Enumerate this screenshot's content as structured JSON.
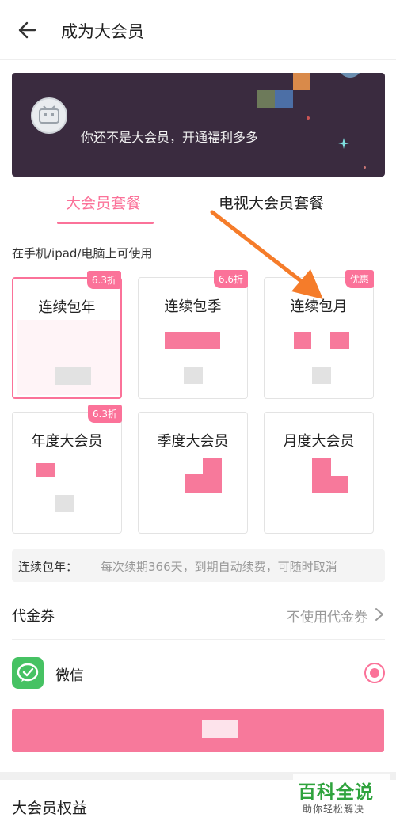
{
  "header": {
    "title": "成为大会员"
  },
  "banner": {
    "text": "你还不是大会员，开通福利多多"
  },
  "tabs": [
    {
      "label": "大会员套餐",
      "active": true
    },
    {
      "label": "电视大会员套餐",
      "active": false
    }
  ],
  "device_note": "在手机/ipad/电脑上可使用",
  "plans": [
    {
      "name": "连续包年",
      "badge": "6.3折",
      "selected": true
    },
    {
      "name": "连续包季",
      "badge": "6.6折",
      "selected": false
    },
    {
      "name": "连续包月",
      "badge": "优惠",
      "selected": false
    },
    {
      "name": "年度大会员",
      "badge": "6.3折",
      "selected": false
    },
    {
      "name": "季度大会员",
      "badge": "",
      "selected": false
    },
    {
      "name": "月度大会员",
      "badge": "",
      "selected": false
    }
  ],
  "notice": {
    "label": "连续包年：",
    "text": "每次续期366天，到期自动续费，可随时取消"
  },
  "voucher": {
    "label": "代金券",
    "value": "不使用代金券"
  },
  "payment": {
    "method": "微信",
    "selected": true
  },
  "benefits_title": "大会员权益",
  "watermark": {
    "title": "百科全说",
    "subtitle": "助你轻松解决"
  },
  "colors": {
    "accent": "#fb7299",
    "banner_bg": "#3a2b3f",
    "wechat": "#46c263",
    "annotation_arrow": "#f57c2a"
  }
}
